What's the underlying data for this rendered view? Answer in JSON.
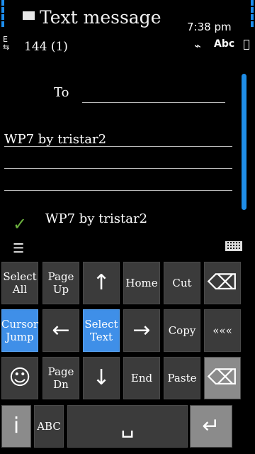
{
  "app": {
    "title": "Text message",
    "time": "7:38 pm",
    "count": "144 (1)",
    "input_mode": "Abc"
  },
  "compose": {
    "to_label": "To",
    "message": "WP7 by tristar2",
    "prediction": "WP7 by tristar2"
  },
  "keyboard": {
    "row1": [
      "Select All",
      "Page Up",
      "↑",
      "Home",
      "Cut",
      "⌫"
    ],
    "row2": [
      "Cursor Jump",
      "←",
      "Select Text",
      "→",
      "Copy",
      "«««"
    ],
    "row3": [
      "☺",
      "Page Dn",
      "↓",
      "End",
      "Paste",
      "⌫"
    ],
    "row4": [
      "i",
      "ABC",
      "␣",
      "↵"
    ]
  },
  "colors": {
    "accent": "#1d8ff0",
    "check": "#6db33f"
  }
}
